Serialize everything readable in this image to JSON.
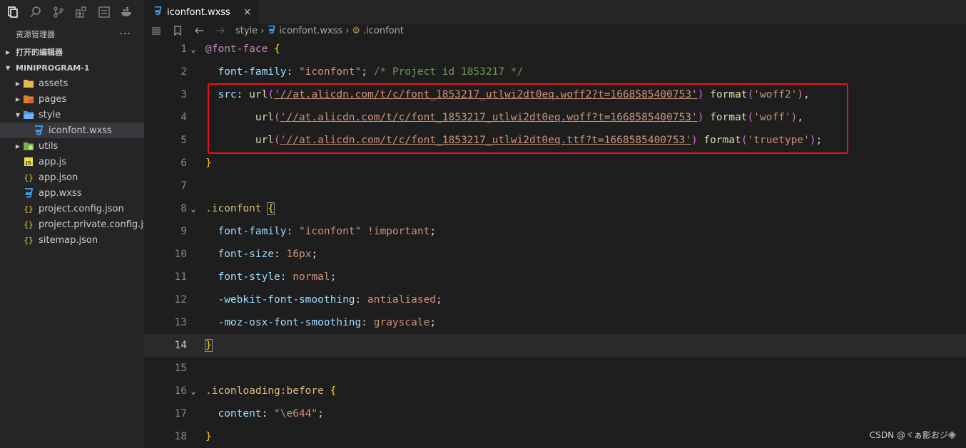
{
  "sidebar": {
    "title": "资源管理器",
    "more": "···",
    "open_editors": "打开的编辑器",
    "project": "MINIPROGRAM-1",
    "items": [
      {
        "label": "assets",
        "type": "folder",
        "expanded": false,
        "icon": "folder-assets-icon",
        "color": "#e8b84a"
      },
      {
        "label": "pages",
        "type": "folder",
        "expanded": false,
        "icon": "folder-pages-icon",
        "color": "#e8704a"
      },
      {
        "label": "style",
        "type": "folder",
        "expanded": true,
        "icon": "folder-style-icon",
        "color": "#4a9be8"
      },
      {
        "label": "iconfont.wxss",
        "type": "file",
        "selected": true,
        "icon": "css-file-icon",
        "color": "#42a5f5"
      },
      {
        "label": "utils",
        "type": "folder",
        "expanded": false,
        "icon": "folder-utils-icon",
        "color": "#7cb342"
      },
      {
        "label": "app.js",
        "type": "file",
        "icon": "js-file-icon",
        "color": "#f0db4f"
      },
      {
        "label": "app.json",
        "type": "file",
        "icon": "json-file-icon",
        "color": "#f0db4f"
      },
      {
        "label": "app.wxss",
        "type": "file",
        "icon": "css-file-icon",
        "color": "#42a5f5"
      },
      {
        "label": "project.config.json",
        "type": "file",
        "icon": "json-file-icon",
        "color": "#f0db4f"
      },
      {
        "label": "project.private.config.js...",
        "type": "file",
        "icon": "json-file-icon",
        "color": "#f0db4f"
      },
      {
        "label": "sitemap.json",
        "type": "file",
        "icon": "json-file-icon",
        "color": "#f0db4f"
      }
    ]
  },
  "tab": {
    "label": "iconfont.wxss",
    "close": "×"
  },
  "breadcrumb": {
    "folder": "style",
    "file": "iconfont.wxss",
    "symbol": ".iconfont"
  },
  "code": {
    "l1": {
      "n": "1",
      "a": "@font-face",
      "b": "{"
    },
    "l2": {
      "n": "2",
      "prop": "font-family",
      "val": "\"iconfont\"",
      "cmt": "/* Project id 1853217 */"
    },
    "l3": {
      "n": "3",
      "prop": "src",
      "url": "'//at.alicdn.com/t/c/font_1853217_utlwi2dt0eq.woff2?t=1668585400753'",
      "fmt": "'woff2'",
      "end": ","
    },
    "l4": {
      "n": "4",
      "url": "'//at.alicdn.com/t/c/font_1853217_utlwi2dt0eq.woff?t=1668585400753'",
      "fmt": "'woff'",
      "end": ","
    },
    "l5": {
      "n": "5",
      "url": "'//at.alicdn.com/t/c/font_1853217_utlwi2dt0eq.ttf?t=1668585400753'",
      "fmt": "'truetype'",
      "end": ";"
    },
    "l6": {
      "n": "6",
      "b": "}"
    },
    "l7": {
      "n": "7"
    },
    "l8": {
      "n": "8",
      "sel": ".iconfont",
      "b": "{"
    },
    "l9": {
      "n": "9",
      "prop": "font-family",
      "val": "\"iconfont\"",
      "imp": "!important"
    },
    "l10": {
      "n": "10",
      "prop": "font-size",
      "val": "16px"
    },
    "l11": {
      "n": "11",
      "prop": "font-style",
      "val": "normal"
    },
    "l12": {
      "n": "12",
      "prop": "-webkit-font-smoothing",
      "val": "antialiased"
    },
    "l13": {
      "n": "13",
      "prop": "-moz-osx-font-smoothing",
      "val": "grayscale"
    },
    "l14": {
      "n": "14",
      "b": "}"
    },
    "l15": {
      "n": "15"
    },
    "l16": {
      "n": "16",
      "sel": ".iconloading",
      "pseudo": ":before",
      "b": "{"
    },
    "l17": {
      "n": "17",
      "prop": "content",
      "val": "\"\\e644\""
    },
    "l18": {
      "n": "18",
      "b": "}"
    }
  },
  "watermark": "CSDN @ヾぁ影おジ𖠁",
  "colors": {
    "highlight": "#e81123",
    "background": "#1e1e1e",
    "sidebar": "#252526"
  }
}
